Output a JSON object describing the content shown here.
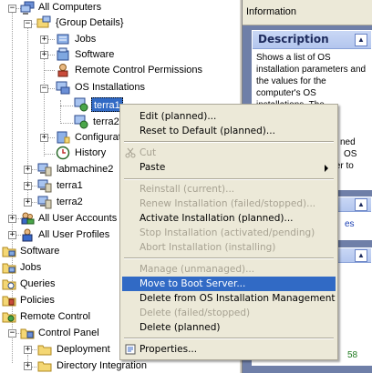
{
  "tree": {
    "items": [
      {
        "label": "All Computers",
        "icon": "computers-icon",
        "expander": "-"
      },
      {
        "label": "{Group Details}",
        "icon": "group-details-icon",
        "expander": "-"
      },
      {
        "label": "Jobs",
        "icon": "jobs-icon",
        "expander": "+"
      },
      {
        "label": "Software",
        "icon": "software-icon",
        "expander": "+"
      },
      {
        "label": "Remote Control Permissions",
        "icon": "remote-control-permissions-icon",
        "expander": ""
      },
      {
        "label": "OS Installations",
        "icon": "os-installations-icon",
        "expander": "-"
      },
      {
        "label": "terra1",
        "icon": "os-install-item-icon",
        "expander": ""
      },
      {
        "label": "terra2",
        "icon": "os-install-item-icon",
        "expander": ""
      },
      {
        "label": "Configuration",
        "icon": "configuration-icon",
        "expander": "+"
      },
      {
        "label": "History",
        "icon": "history-icon",
        "expander": ""
      },
      {
        "label": "labmachine2",
        "icon": "computer-icon",
        "expander": "+"
      },
      {
        "label": "terra1",
        "icon": "computer-icon",
        "expander": "+"
      },
      {
        "label": "terra2",
        "icon": "computer-icon",
        "expander": "+"
      },
      {
        "label": "All User Accounts",
        "icon": "user-accounts-icon",
        "expander": "+"
      },
      {
        "label": "All User Profiles",
        "icon": "user-profiles-icon",
        "expander": "+"
      },
      {
        "label": "Software",
        "icon": "software-folder-icon",
        "expander": ""
      },
      {
        "label": "Jobs",
        "icon": "jobs-folder-icon",
        "expander": ""
      },
      {
        "label": "Queries",
        "icon": "queries-icon",
        "expander": ""
      },
      {
        "label": "Policies",
        "icon": "policies-icon",
        "expander": ""
      },
      {
        "label": "Remote Control",
        "icon": "remote-control-icon",
        "expander": ""
      },
      {
        "label": "Control Panel",
        "icon": "control-panel-icon",
        "expander": "-"
      },
      {
        "label": "Deployment",
        "icon": "folder-icon",
        "expander": "+"
      },
      {
        "label": "Directory Integration",
        "icon": "folder-icon",
        "expander": "+"
      }
    ]
  },
  "info": {
    "header": "Information",
    "description_title": "Description",
    "description_text": "Shows a list of OS installation parameters and the values for the computer's OS installations. The",
    "obscured_fragments": [
      "ned",
      "OS",
      "ter to"
    ],
    "panel2_fragment": "es",
    "panel3_fragment": "58"
  },
  "context_menu": {
    "items": [
      {
        "label": "Edit (planned)...",
        "enabled": true
      },
      {
        "label": "Reset to Default (planned)...",
        "enabled": true
      },
      {
        "separator": true
      },
      {
        "label": "Cut",
        "enabled": false,
        "icon": "scissors-icon"
      },
      {
        "label": "Paste",
        "enabled": true,
        "submenu": true
      },
      {
        "separator": true
      },
      {
        "label": "Reinstall (current)...",
        "enabled": false
      },
      {
        "label": "Renew Installation (failed/stopped)...",
        "enabled": false
      },
      {
        "label": "Activate Installation (planned)...",
        "enabled": true
      },
      {
        "label": "Stop Installation (activated/pending)",
        "enabled": false
      },
      {
        "label": "Abort Installation (installing)",
        "enabled": false
      },
      {
        "separator": true
      },
      {
        "label": "Manage (unmanaged)...",
        "enabled": false
      },
      {
        "label": "Move to Boot Server...",
        "enabled": true,
        "highlighted": true
      },
      {
        "label": "Delete from OS Installation Management",
        "enabled": true
      },
      {
        "label": "Delete (failed/stopped)",
        "enabled": false
      },
      {
        "label": "Delete (planned)",
        "enabled": true
      },
      {
        "separator": true
      },
      {
        "label": "Properties...",
        "enabled": true,
        "icon": "properties-icon"
      }
    ]
  },
  "colors": {
    "selection": "#316ac5",
    "menu_bg": "#ece9d8",
    "disabled_text": "#a7a292",
    "right_pane_bg": "#6f7fa8",
    "panel_header": "#c9d7f5"
  }
}
